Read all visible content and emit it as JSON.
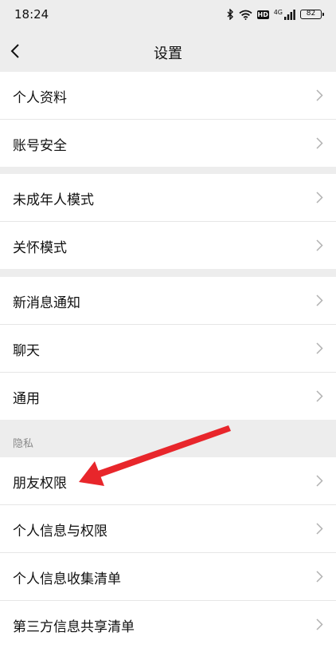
{
  "status_bar": {
    "time": "18:24",
    "network_label": "4G",
    "hd_label": "HD",
    "battery": "82",
    "icons": [
      "bluetooth-icon",
      "wifi-icon",
      "hd-icon",
      "signal-icon",
      "battery-icon"
    ]
  },
  "nav": {
    "title": "设置",
    "back_icon": "chevron-left-icon"
  },
  "groups": [
    {
      "items": [
        {
          "label": "个人资料"
        },
        {
          "label": "账号安全"
        }
      ]
    },
    {
      "items": [
        {
          "label": "未成年人模式"
        },
        {
          "label": "关怀模式"
        }
      ]
    },
    {
      "items": [
        {
          "label": "新消息通知"
        },
        {
          "label": "聊天"
        },
        {
          "label": "通用"
        }
      ]
    },
    {
      "section_label": "隐私",
      "items": [
        {
          "label": "朋友权限"
        },
        {
          "label": "个人信息与权限"
        },
        {
          "label": "个人信息收集清单"
        },
        {
          "label": "第三方信息共享清单"
        }
      ]
    }
  ],
  "annotation": {
    "color": "#e8262b",
    "icon": "red-arrow-pointer",
    "points_to": "朋友权限"
  },
  "colors": {
    "background": "#ededed",
    "row": "#ffffff",
    "divider": "#e6e6e6",
    "chevron": "#b2b2b2",
    "section_text": "#8a8a8a"
  }
}
